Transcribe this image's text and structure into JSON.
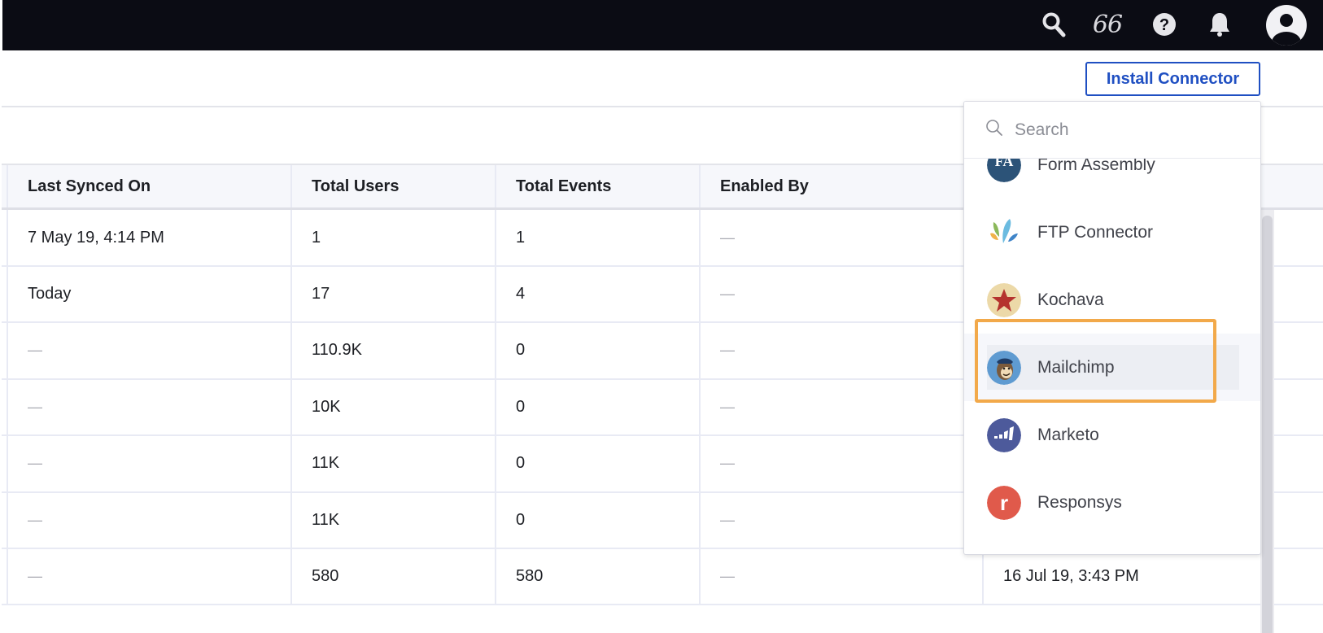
{
  "topbar": {
    "icons": [
      "search-icon",
      "quote-icon",
      "help-icon",
      "bell-icon",
      "avatar"
    ],
    "quote_glyph": "66",
    "help_glyph": "?"
  },
  "toolbar": {
    "install_connector_label": "Install Connector"
  },
  "table": {
    "columns": [
      "Last Synced On",
      "Total Users",
      "Total Events",
      "Enabled By",
      ""
    ],
    "rows": [
      {
        "last_synced": "7 May 19, 4:14 PM",
        "total_users": "1",
        "total_events": "1",
        "enabled_by": "—",
        "extra": ""
      },
      {
        "last_synced": "Today",
        "total_users": "17",
        "total_events": "4",
        "enabled_by": "—",
        "extra": ""
      },
      {
        "last_synced": "—",
        "total_users": "110.9K",
        "total_events": "0",
        "enabled_by": "—",
        "extra": ""
      },
      {
        "last_synced": "—",
        "total_users": "10K",
        "total_events": "0",
        "enabled_by": "—",
        "extra": ""
      },
      {
        "last_synced": "—",
        "total_users": "11K",
        "total_events": "0",
        "enabled_by": "—",
        "extra": ""
      },
      {
        "last_synced": "—",
        "total_users": "11K",
        "total_events": "0",
        "enabled_by": "—",
        "extra": ""
      },
      {
        "last_synced": "—",
        "total_users": "580",
        "total_events": "580",
        "enabled_by": "—",
        "extra": "16 Jul 19, 3:43 PM"
      }
    ]
  },
  "connector_dropdown": {
    "search_placeholder": "Search",
    "search_value": "",
    "items": [
      {
        "label": "Form Assembly",
        "icon": "form-assembly-logo",
        "logo_text": "FA",
        "color": "#2c5378"
      },
      {
        "label": "FTP Connector",
        "icon": "ftp-connector-logo",
        "logo_text": "",
        "color": "#6bbbe0"
      },
      {
        "label": "Kochava",
        "icon": "kochava-logo",
        "logo_text": "★",
        "color": "#ecd9a8"
      },
      {
        "label": "Mailchimp",
        "icon": "mailchimp-logo",
        "logo_text": "",
        "color": "#5f9bd1",
        "hovered": true,
        "highlighted": true
      },
      {
        "label": "Marketo",
        "icon": "marketo-logo",
        "logo_text": "",
        "color": "#4d5a9b"
      },
      {
        "label": "Responsys",
        "icon": "responsys-logo",
        "logo_text": "r",
        "color": "#e05a4b"
      }
    ]
  },
  "colors": {
    "topbar_bg": "#0b0c14",
    "accent": "#1f4fc2",
    "highlight": "#f2a94a",
    "header_bg": "#f6f7fb"
  }
}
